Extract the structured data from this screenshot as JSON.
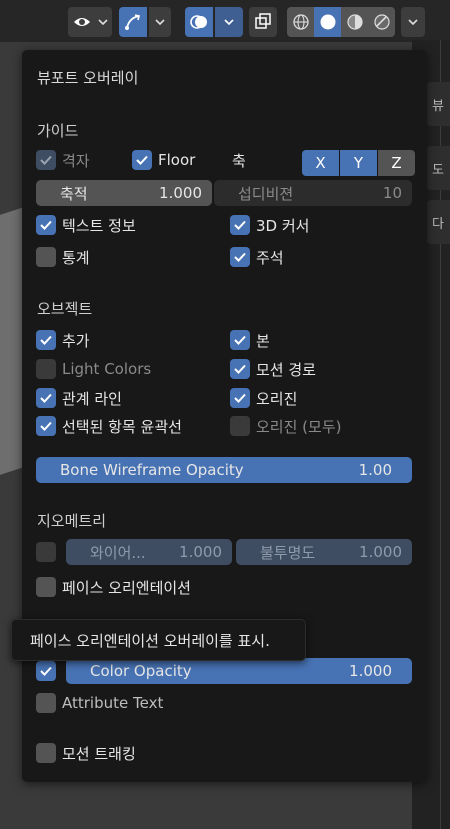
{
  "popover": {
    "title": "뷰포트 오버레이",
    "guides": {
      "title": "가이드",
      "grid": "격자",
      "floor": "Floor",
      "axes_label": "축",
      "axes": [
        "X",
        "Y",
        "Z"
      ],
      "scale_label": "축적",
      "scale_value": "1.000",
      "subdivisions_label": "섭디비젼",
      "subdivisions_value": "10",
      "text_info": "텍스트 정보",
      "cursor_3d": "3D 커서",
      "statistics": "통계",
      "annotations": "주석"
    },
    "objects": {
      "title": "오브젝트",
      "extras": "추가",
      "bones": "본",
      "light_colors": "Light Colors",
      "motion_paths": "모션 경로",
      "relationship_lines": "관계 라인",
      "origins": "오리진",
      "selected_outline": "선택된 항목 윤곽선",
      "origins_all": "오리진 (모두)",
      "bone_wireframe_label": "Bone Wireframe Opacity",
      "bone_wireframe_value": "1.00"
    },
    "geometry": {
      "title": "지오메트리",
      "wireframe_label": "와이어...",
      "wireframe_value": "1.000",
      "opacity_label": "불투명도",
      "opacity_value": "1.000",
      "face_orientation": "페이스 오리엔테이션"
    },
    "attributes": {
      "color_opacity_label": "Color Opacity",
      "color_opacity_value": "1.000",
      "attribute_text": "Attribute Text"
    },
    "motion_tracking": "모션 트래킹"
  },
  "tooltip": "페이스 오리엔테이션 오버레이를 표시.",
  "right_tabs": [
    "뷰",
    "도",
    "다"
  ],
  "colors": {
    "accent": "#4772b3",
    "popover_bg": "#181818",
    "widget": "#545454"
  }
}
